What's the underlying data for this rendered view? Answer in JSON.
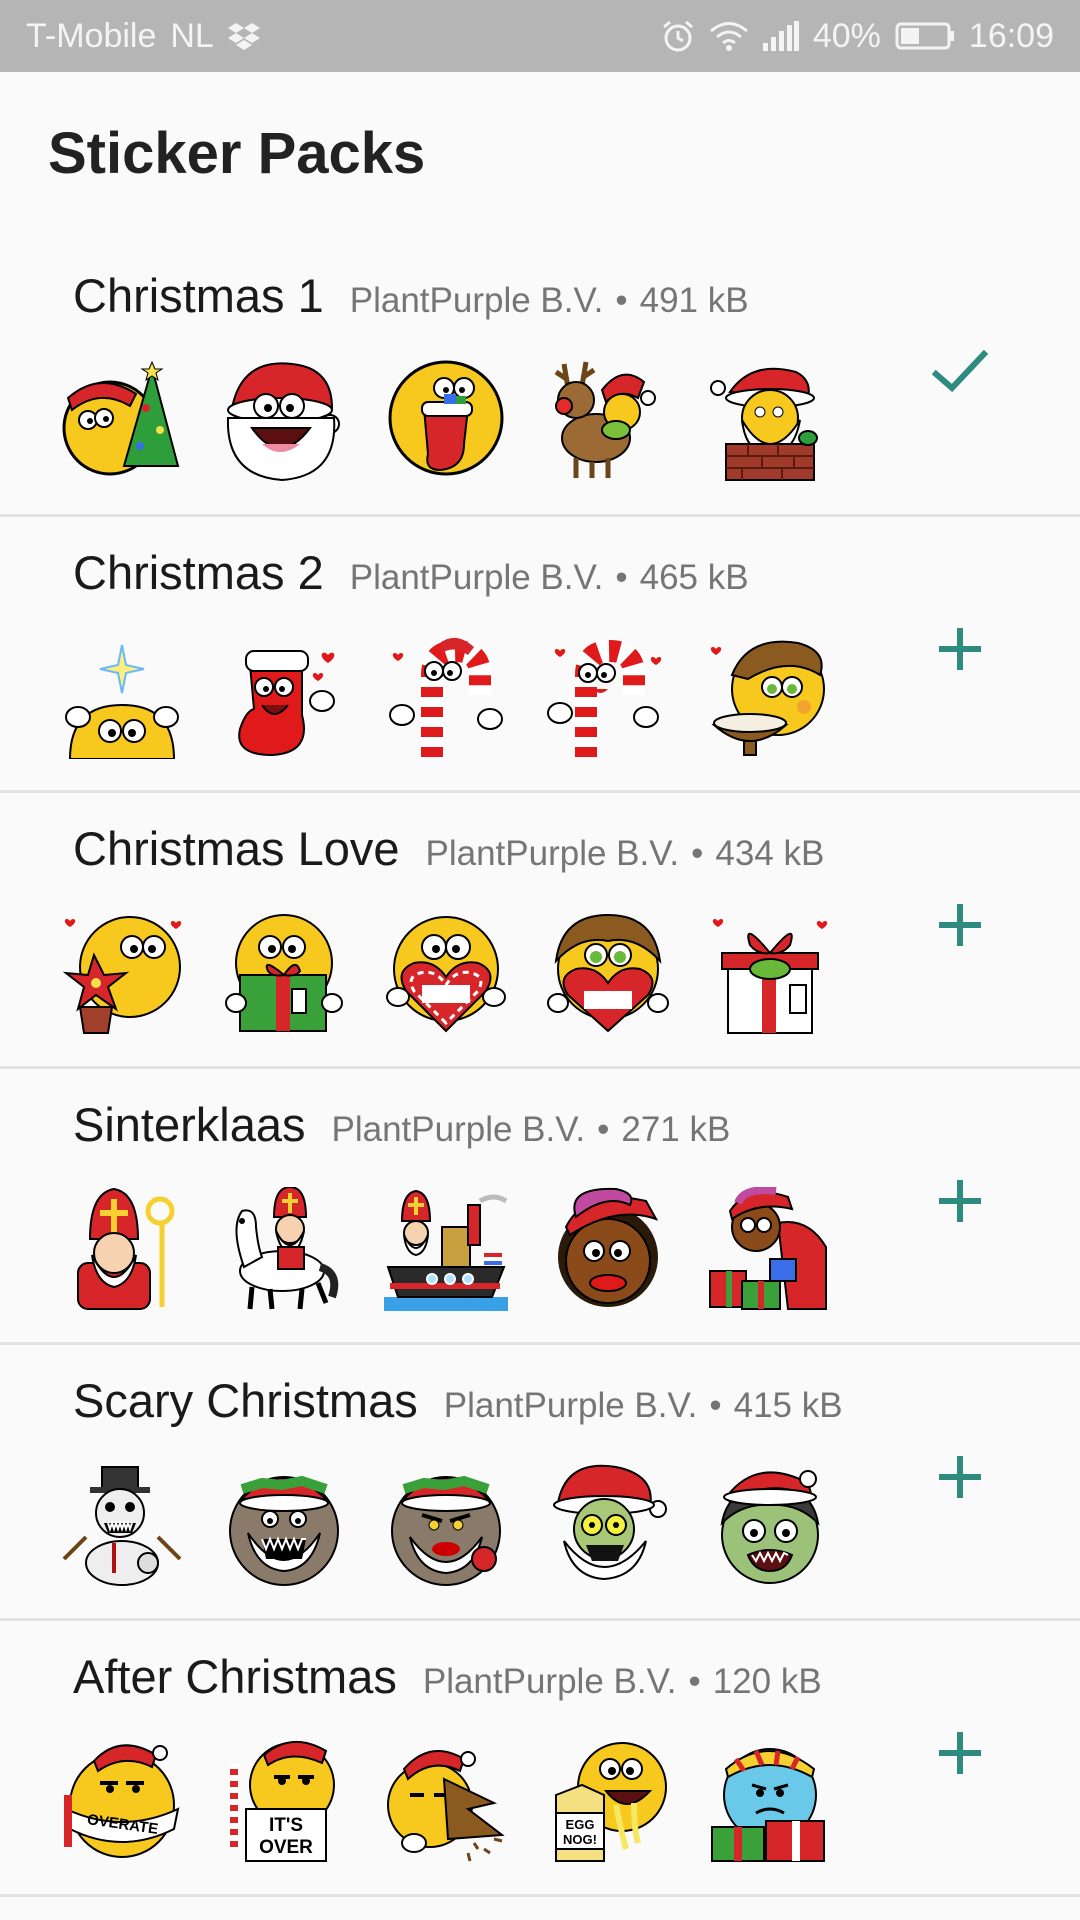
{
  "status_bar": {
    "carrier": "T-Mobile",
    "network": "NL",
    "battery": "40%",
    "time": "16:09",
    "icons": [
      "dropbox-icon",
      "alarm-icon",
      "wifi-icon",
      "signal-icon",
      "battery-icon"
    ]
  },
  "page": {
    "title": "Sticker Packs"
  },
  "colors": {
    "accent": "#2e8b80",
    "status_bar": "#b5b5b5",
    "background": "#fafafa"
  },
  "packs": [
    {
      "name": "Christmas 1",
      "publisher": "PlantPurple B.V.",
      "separator": "•",
      "size": "491 kB",
      "status": "added",
      "action_icon": "check-icon",
      "stickers": [
        "emoji-with-christmas-tree",
        "santa-laughing",
        "emoji-with-stocking",
        "reindeer-with-santa-hat",
        "santa-in-chimney"
      ]
    },
    {
      "name": "Christmas 2",
      "publisher": "PlantPurple B.V.",
      "separator": "•",
      "size": "465 kB",
      "status": "not-added",
      "action_icon": "plus-icon",
      "stickers": [
        "emoji-with-star",
        "red-stocking",
        "candy-cane",
        "candy-cane-with-hearts",
        "emoji-with-bowl"
      ]
    },
    {
      "name": "Christmas Love",
      "publisher": "PlantPurple B.V.",
      "separator": "•",
      "size": "434 kB",
      "status": "not-added",
      "action_icon": "plus-icon",
      "stickers": [
        "emoji-with-poinsettia",
        "emoji-with-gift",
        "emoji-with-heart",
        "emoji-girl-with-heart",
        "gift-box"
      ]
    },
    {
      "name": "Sinterklaas",
      "publisher": "PlantPurple B.V.",
      "separator": "•",
      "size": "271 kB",
      "status": "not-added",
      "action_icon": "plus-icon",
      "stickers": [
        "sinterklaas",
        "sinterklaas-on-horse",
        "steamboat",
        "piet-face",
        "piet-with-presents"
      ]
    },
    {
      "name": "Scary Christmas",
      "publisher": "PlantPurple B.V.",
      "separator": "•",
      "size": "415 kB",
      "status": "not-added",
      "action_icon": "plus-icon",
      "stickers": [
        "scary-snowman",
        "scary-santa",
        "angry-santa",
        "zombie-santa",
        "zombie-face"
      ]
    },
    {
      "name": "After Christmas",
      "publisher": "PlantPurple B.V.",
      "separator": "•",
      "size": "120 kB",
      "status": "not-added",
      "action_icon": "plus-icon",
      "stickers": [
        "emoji-overate",
        "emoji-its-over",
        "emoji-broken-tree",
        "emoji-egg-nog",
        "blue-emoji-with-gifts"
      ],
      "sticker_text": {
        "overate": "OVERATE",
        "its_over_1": "IT'S",
        "its_over_2": "OVER",
        "egg_nog_1": "EGG",
        "egg_nog_2": "NOG!"
      }
    }
  ]
}
